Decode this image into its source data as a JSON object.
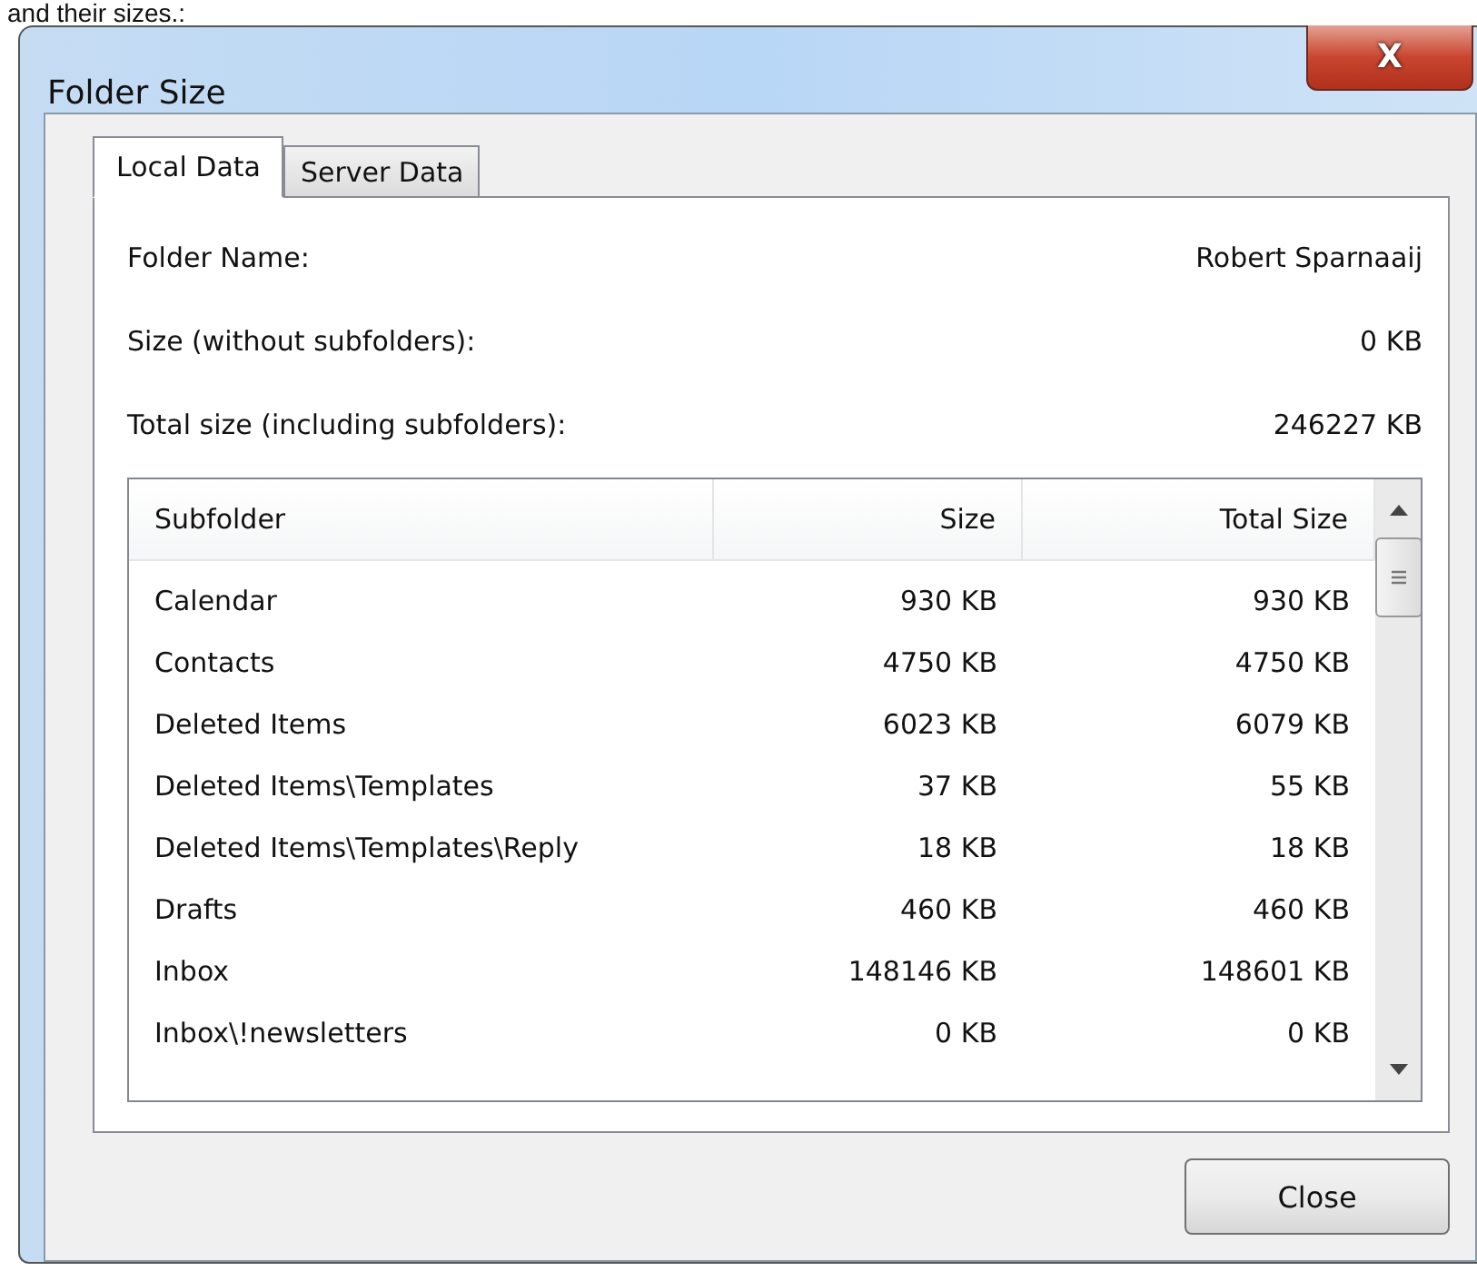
{
  "caption": "and their sizes.:",
  "window": {
    "title": "Folder Size",
    "close_glyph": "X"
  },
  "tabs": [
    {
      "label": "Local Data",
      "selected": true
    },
    {
      "label": "Server Data",
      "selected": false
    }
  ],
  "fields": [
    {
      "label": "Folder Name:",
      "value": "Robert Sparnaaij"
    },
    {
      "label": "Size (without subfolders):",
      "value": "0 KB"
    },
    {
      "label": "Total size (including subfolders):",
      "value": "246227 KB"
    }
  ],
  "table": {
    "columns": [
      "Subfolder",
      "Size",
      "Total Size"
    ],
    "rows": [
      [
        "Calendar",
        "930 KB",
        "930 KB"
      ],
      [
        "Contacts",
        "4750 KB",
        "4750 KB"
      ],
      [
        "Deleted Items",
        "6023 KB",
        "6079 KB"
      ],
      [
        "Deleted Items\\Templates",
        "37 KB",
        "55 KB"
      ],
      [
        "Deleted Items\\Templates\\Reply",
        "18 KB",
        "18 KB"
      ],
      [
        "Drafts",
        "460 KB",
        "460 KB"
      ],
      [
        "Inbox",
        "148146 KB",
        "148601 KB"
      ],
      [
        "Inbox\\!newsletters",
        "0 KB",
        "0 KB"
      ]
    ]
  },
  "buttons": [
    "Close"
  ]
}
